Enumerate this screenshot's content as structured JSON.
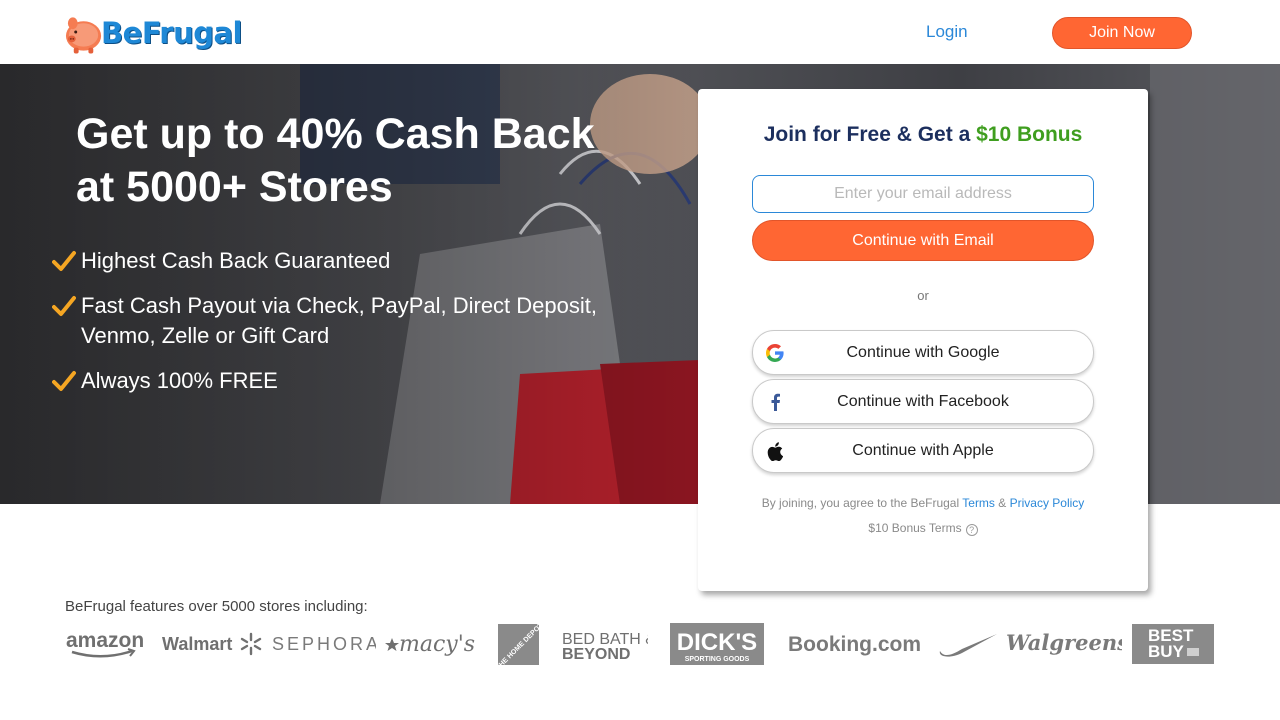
{
  "header": {
    "brand": "BeFrugal",
    "login_label": "Login",
    "join_label": "Join Now"
  },
  "hero": {
    "title_line1": "Get up to 40% Cash Back",
    "title_line2": "at 5000+ Stores",
    "benefits": [
      {
        "line1": "Highest Cash Back Guaranteed",
        "line2": ""
      },
      {
        "line1": "Fast Cash Payout via Check, PayPal, Direct Deposit,",
        "line2": "Venmo, Zelle or Gift Card"
      },
      {
        "line1": "Always 100% FREE",
        "line2": ""
      }
    ]
  },
  "signup": {
    "title_prefix": "Join for Free & Get a ",
    "title_bonus": "$10 Bonus",
    "email_placeholder": "Enter your email address",
    "email_value": "",
    "continue_email": "Continue with Email",
    "or": "or",
    "google": "Continue with Google",
    "facebook": "Continue with Facebook",
    "apple": "Continue with Apple",
    "terms_prefix": "By joining, you agree to the BeFrugal ",
    "terms_link": "Terms",
    "terms_amp": " & ",
    "privacy_link": "Privacy Policy",
    "bonus_terms": "$10 Bonus Terms"
  },
  "stores": {
    "caption": "BeFrugal features over 5000 stores including:",
    "logos": [
      "amazon",
      "Walmart",
      "SEPHORA",
      "macy's",
      "THE HOME DEPOT",
      "BED BATH & BEYOND",
      "DICK'S SPORTING GOODS",
      "Booking.com",
      "Nike",
      "Walgreens",
      "BEST BUY"
    ]
  },
  "colors": {
    "accent_orange": "#ff6633",
    "link_blue": "#2b88d8",
    "title_navy": "#1c2f5e",
    "bonus_green": "#3f9e1f",
    "check_orange": "#f5a623"
  },
  "icons": [
    "piggy-bank-logo-icon",
    "check-icon",
    "google-icon",
    "facebook-icon",
    "apple-icon",
    "help-icon"
  ]
}
